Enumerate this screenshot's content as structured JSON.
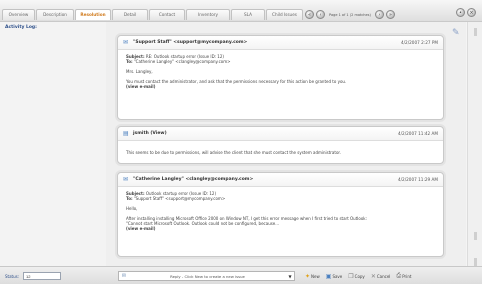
{
  "tabs": [
    {
      "label": "Overview",
      "active": false
    },
    {
      "label": "Description",
      "active": false
    },
    {
      "label": "Resolution",
      "active": true
    },
    {
      "label": "Detail",
      "active": false
    },
    {
      "label": "Contact",
      "active": false
    },
    {
      "label": "Inventory",
      "active": false
    },
    {
      "label": "SLA",
      "active": false
    },
    {
      "label": "Child Issues",
      "active": false
    }
  ],
  "pager": {
    "text": "Page 1 of 1 (2 matches)"
  },
  "left": {
    "activity_label": "Activity Log:"
  },
  "messages": [
    {
      "icon": "email-icon",
      "from": "\"Support Staff\" <support@mycompany.com>",
      "date": "4/2/2007 2:27 PM",
      "subject_label": "Subject:",
      "subject": "RE: Outlook startup error (Issue ID: 12)",
      "to_label": "To:",
      "to": "\"Catherine Langley\" <clangley@company.com>",
      "greeting": "Mrs. Langley,",
      "body": "You must contact the administrator, and ask that the permissions necessary for this action be granted to you.",
      "view_link": "(view e-mail)"
    },
    {
      "icon": "note-icon",
      "from": "jsmith (View)",
      "date": "4/2/2007 11:42 AM",
      "body": "This seems to be due to permissions, will advise the client that she must contact the system administrator."
    },
    {
      "icon": "email-icon",
      "from": "\"Catherine Langley\" <clangley@company.com>",
      "date": "4/2/2007 11:29 AM",
      "subject_label": "Subject:",
      "subject": "Outlook startup error (Issue ID: 12)",
      "to_label": "To:",
      "to": "\"Support Staff\" <support@mycompany.com>",
      "greeting": "Hello,",
      "body": "After installing installing Microsoft Office 2000 on Window NT, I get this error message when I first tried to start Outlook:",
      "body2": "\"Cannot start Microsoft Outlook. Outlook could not be configured, because...",
      "view_link": "(view e-mail)"
    }
  ],
  "bottom": {
    "status_label": "Status:",
    "status_value": "12",
    "reply_select": "Reply - Click New to create a new issue",
    "actions": [
      {
        "label": "New",
        "icon": "new-icon"
      },
      {
        "label": "Save",
        "icon": "save-icon"
      },
      {
        "label": "Copy",
        "icon": "copy-icon"
      },
      {
        "label": "Cancel",
        "icon": "cancel-icon"
      },
      {
        "label": "Print",
        "icon": "print-icon"
      }
    ]
  },
  "colors": {
    "active_tab": "#d07a1c",
    "label_blue": "#2d4f8a",
    "icon_blue": "#4a7fbf"
  }
}
